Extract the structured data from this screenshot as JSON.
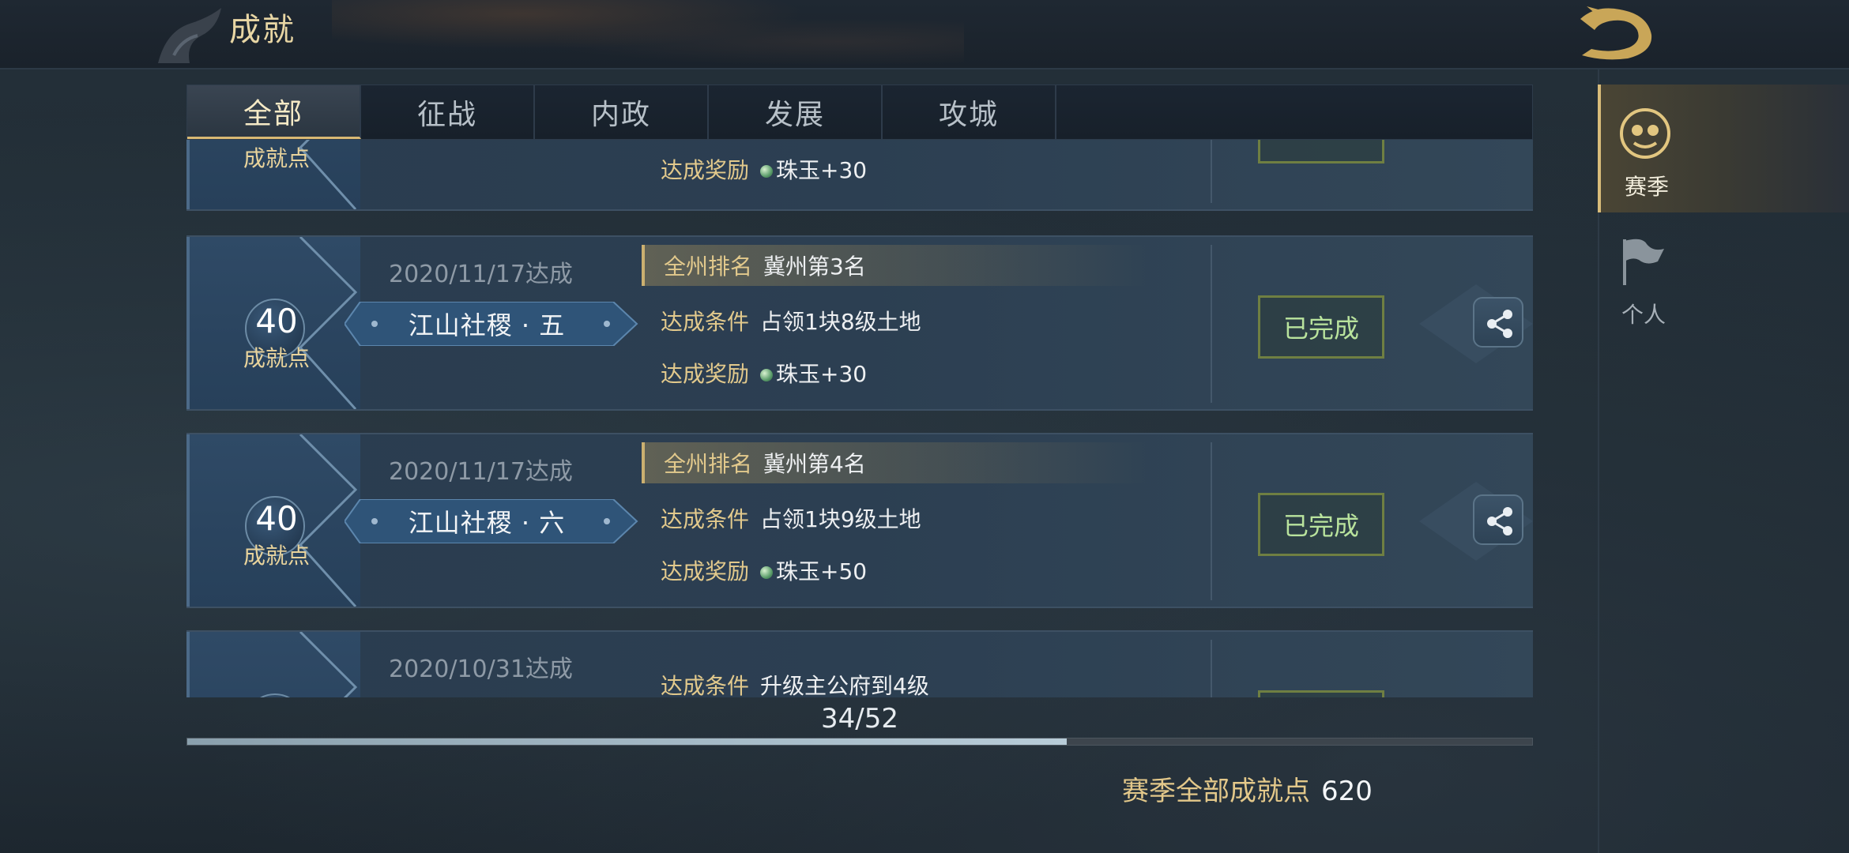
{
  "header": {
    "title": "成就"
  },
  "tabs": [
    {
      "label": "全部",
      "active": true
    },
    {
      "label": "征战",
      "active": false
    },
    {
      "label": "内政",
      "active": false
    },
    {
      "label": "发展",
      "active": false
    },
    {
      "label": "攻城",
      "active": false
    }
  ],
  "achievements": [
    {
      "points_label": "成就点",
      "reward_label": "达成奖励",
      "reward": "珠玉+30"
    },
    {
      "date": "2020/11/17达成",
      "points": "40",
      "points_label": "成就点",
      "name": "江山社稷 · 五",
      "rank_label": "全州排名",
      "rank": "冀州第3名",
      "condition_label": "达成条件",
      "condition": "占领1块8级土地",
      "reward_label": "达成奖励",
      "reward": "珠玉+30",
      "status": "已完成"
    },
    {
      "date": "2020/11/17达成",
      "points": "40",
      "points_label": "成就点",
      "name": "江山社稷 · 六",
      "rank_label": "全州排名",
      "rank": "冀州第4名",
      "condition_label": "达成条件",
      "condition": "占领1块9级土地",
      "reward_label": "达成奖励",
      "reward": "珠玉+50",
      "status": "已完成"
    },
    {
      "date": "2020/10/31达成",
      "condition_label": "达成条件",
      "condition": "升级主公府到4级"
    }
  ],
  "progress": {
    "text": "34/52",
    "completed": 34,
    "total": 52
  },
  "season_total": {
    "label": "赛季全部成就点",
    "value": "620"
  },
  "side_nav": [
    {
      "label": "赛季",
      "icon": "season-mask-icon",
      "active": true
    },
    {
      "label": "个人",
      "icon": "personal-flag-icon",
      "active": false
    }
  ],
  "colors": {
    "accent_gold": "#d9bc7a",
    "done_green": "#b9e39d",
    "card_blue": "#2c3f52"
  }
}
